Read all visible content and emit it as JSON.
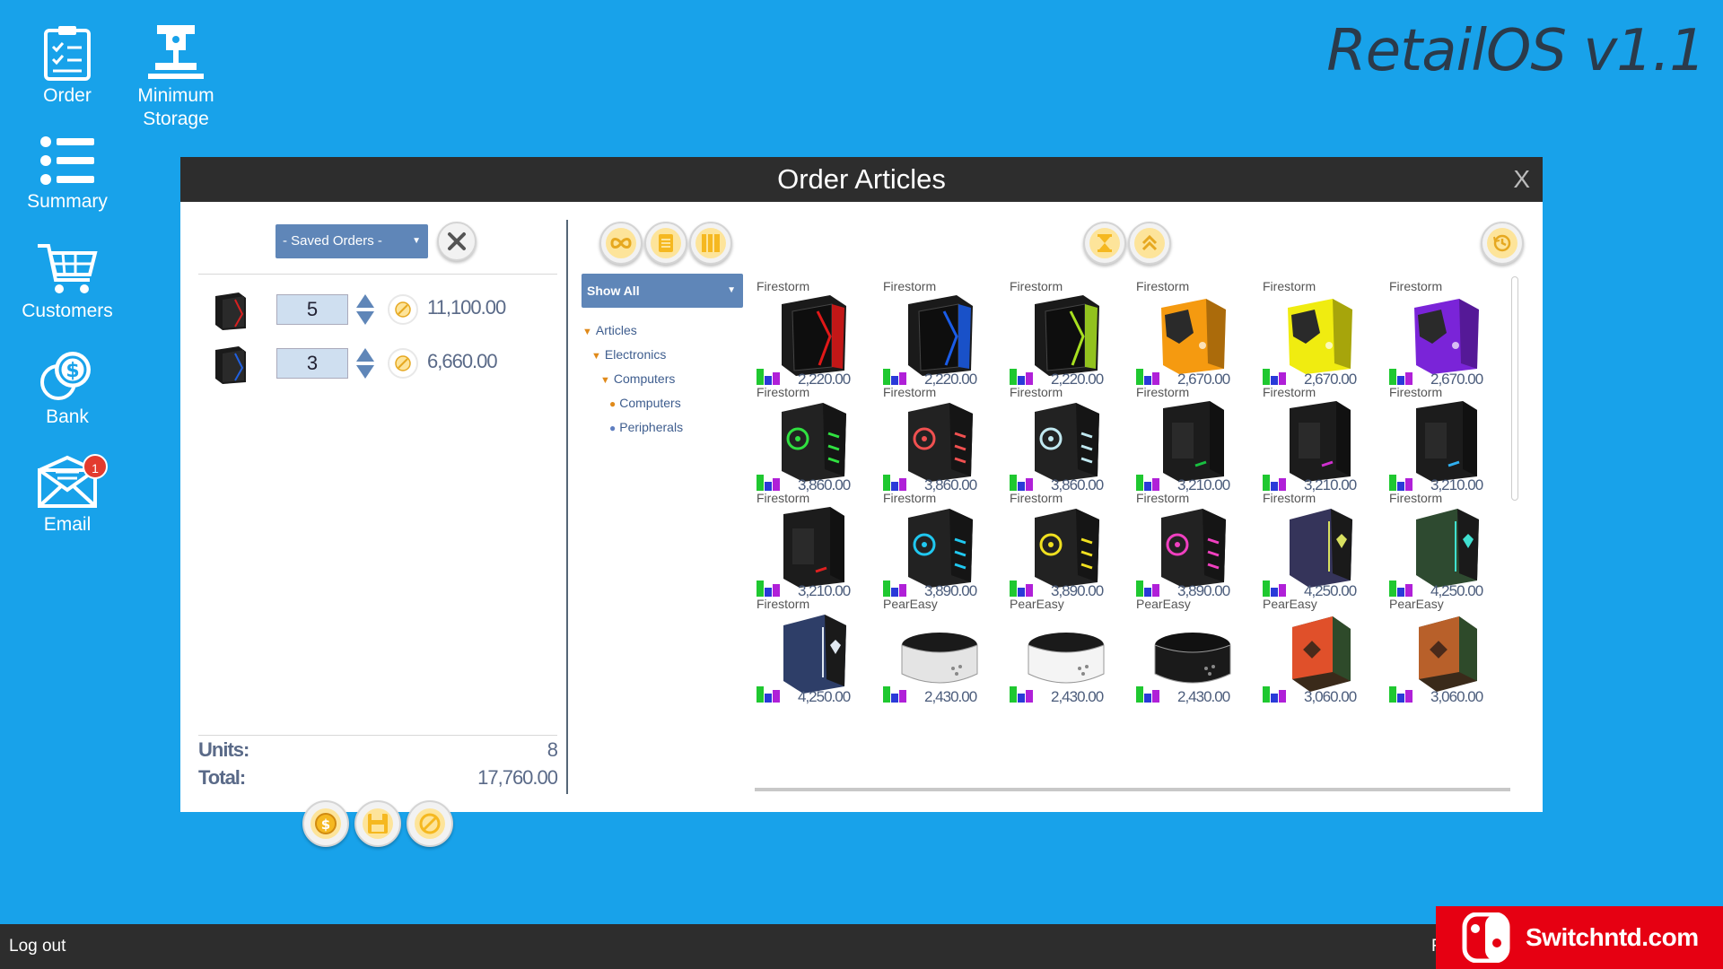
{
  "desktop": {
    "os_title": "RetailOS v1.1",
    "icons": [
      {
        "id": "order",
        "label": "Order"
      },
      {
        "id": "minimum-storage",
        "label": "Minimum Storage"
      },
      {
        "id": "summary",
        "label": "Summary"
      },
      {
        "id": "customers",
        "label": "Customers"
      },
      {
        "id": "bank",
        "label": "Bank"
      },
      {
        "id": "email",
        "label": "Email",
        "badge": "1"
      }
    ]
  },
  "window": {
    "title": "Order Articles",
    "close_glyph": "X"
  },
  "order_panel": {
    "saved_orders_label": "- Saved Orders -",
    "rows": [
      {
        "qty": "5",
        "price": "11,100.00",
        "accent": "#d62020"
      },
      {
        "qty": "3",
        "price": "6,660.00",
        "accent": "#2060e0"
      }
    ],
    "units_label": "Units:",
    "units_value": "8",
    "total_label": "Total:",
    "total_value": "17,760.00"
  },
  "categories": {
    "filter_label": "Show All",
    "tree": [
      {
        "label": "Articles",
        "level": 0,
        "type": "open"
      },
      {
        "label": "Electronics",
        "level": 1,
        "type": "open"
      },
      {
        "label": "Computers",
        "level": 2,
        "type": "open"
      },
      {
        "label": "Computers",
        "level": 3,
        "type": "leaf-orange"
      },
      {
        "label": "Peripherals",
        "level": 3,
        "type": "leaf-blue"
      }
    ]
  },
  "articles": [
    {
      "brand": "Firestorm",
      "price": "2,220.00",
      "style": "tower",
      "accent": "#e01818"
    },
    {
      "brand": "Firestorm",
      "price": "2,220.00",
      "style": "tower",
      "accent": "#1a5ce8"
    },
    {
      "brand": "Firestorm",
      "price": "2,220.00",
      "style": "tower",
      "accent": "#a8e020"
    },
    {
      "brand": "Firestorm",
      "price": "2,670.00",
      "style": "angular",
      "accent": "#f59a10"
    },
    {
      "brand": "Firestorm",
      "price": "2,670.00",
      "style": "angular",
      "accent": "#f0ec10"
    },
    {
      "brand": "Firestorm",
      "price": "2,670.00",
      "style": "angular",
      "accent": "#7a24d8"
    },
    {
      "brand": "Firestorm",
      "price": "3,860.00",
      "style": "fan",
      "accent": "#30e040"
    },
    {
      "brand": "Firestorm",
      "price": "3,860.00",
      "style": "fan",
      "accent": "#f05050"
    },
    {
      "brand": "Firestorm",
      "price": "3,860.00",
      "style": "fan",
      "accent": "#c0e8f0"
    },
    {
      "brand": "Firestorm",
      "price": "3,210.00",
      "style": "plain",
      "accent": "#18c040"
    },
    {
      "brand": "Firestorm",
      "price": "3,210.00",
      "style": "plain",
      "accent": "#d030d0"
    },
    {
      "brand": "Firestorm",
      "price": "3,210.00",
      "style": "plain",
      "accent": "#30b0f0"
    },
    {
      "brand": "Firestorm",
      "price": "3,210.00",
      "style": "plain",
      "accent": "#e02020"
    },
    {
      "brand": "Firestorm",
      "price": "3,890.00",
      "style": "fan",
      "accent": "#20c8f0"
    },
    {
      "brand": "Firestorm",
      "price": "3,890.00",
      "style": "fan",
      "accent": "#f0e020"
    },
    {
      "brand": "Firestorm",
      "price": "3,890.00",
      "style": "fan",
      "accent": "#f040c0"
    },
    {
      "brand": "Firestorm",
      "price": "4,250.00",
      "style": "premium",
      "accent": "#d8e060",
      "body": "#35345a"
    },
    {
      "brand": "Firestorm",
      "price": "4,250.00",
      "style": "premium",
      "accent": "#40e0d0",
      "body": "#2e4a30"
    },
    {
      "brand": "Firestorm",
      "price": "4,250.00",
      "style": "premium",
      "accent": "#e0e8f0",
      "body": "#2e3e68"
    },
    {
      "brand": "PearEasy",
      "price": "2,430.00",
      "style": "console",
      "accent": "#e4e4e4"
    },
    {
      "brand": "PearEasy",
      "price": "2,430.00",
      "style": "console",
      "accent": "#f4f4f4"
    },
    {
      "brand": "PearEasy",
      "price": "2,430.00",
      "style": "console",
      "accent": "#1a1a1a"
    },
    {
      "brand": "PearEasy",
      "price": "3,060.00",
      "style": "boxy",
      "accent": "#e0502a"
    },
    {
      "brand": "PearEasy",
      "price": "3,060.00",
      "style": "boxy",
      "accent": "#b8602a"
    }
  ],
  "taskbar": {
    "logout_label": "Log out",
    "right_text": "F"
  },
  "watermark": {
    "text": "Switchntd.com"
  },
  "colors": {
    "desktop_bg": "#18a2ea",
    "titlebar": "#2d2d2d",
    "dropdown": "#5f86b8",
    "button_yellow": "#fde49a"
  }
}
